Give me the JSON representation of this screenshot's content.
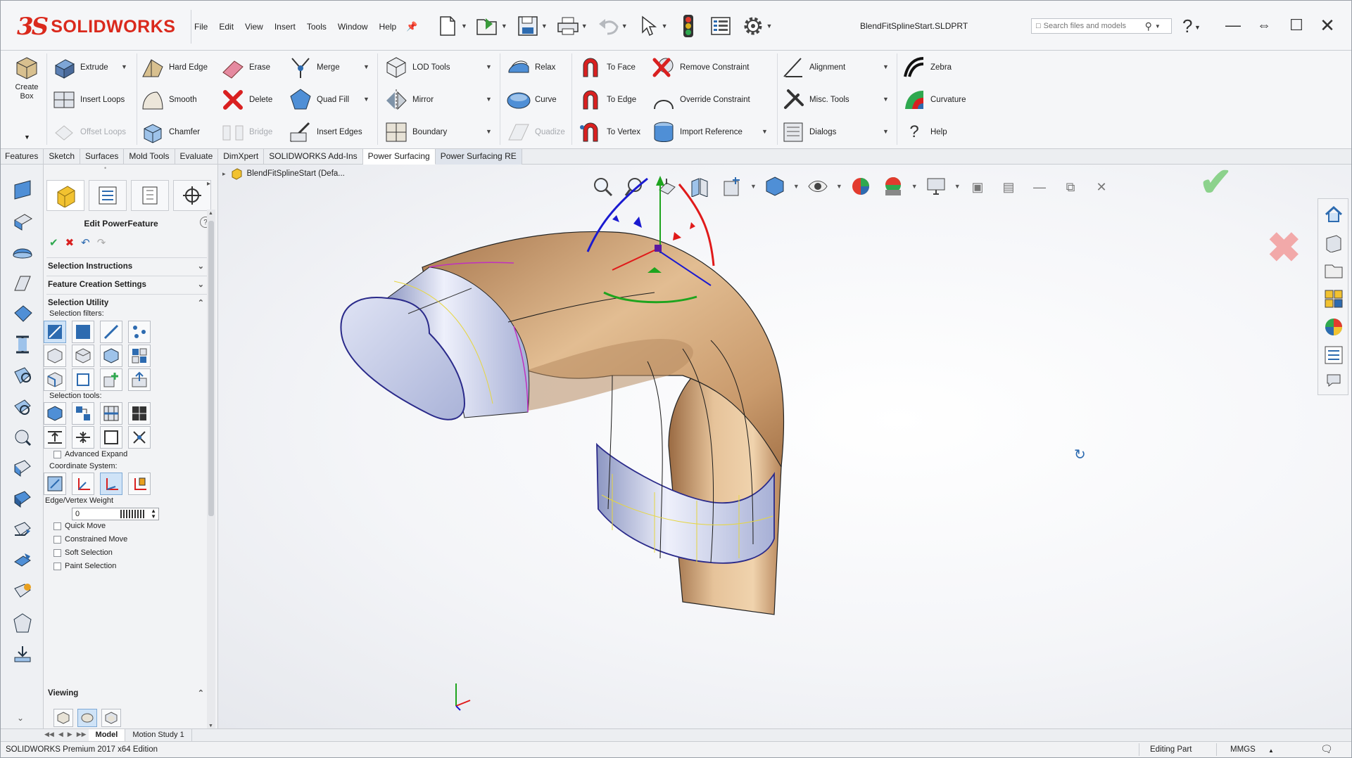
{
  "app": {
    "brand": "SOLIDWORKS",
    "document_title": "BlendFitSplineStart.SLDPRT"
  },
  "menus": [
    "File",
    "Edit",
    "View",
    "Insert",
    "Tools",
    "Window",
    "Help"
  ],
  "search": {
    "placeholder": "Search files and models"
  },
  "ribbon": {
    "create_box": "Create Box",
    "extrude": "Extrude",
    "insert_loops": "Insert Loops",
    "offset_loops": "Offset Loops",
    "hard_edge": "Hard Edge",
    "smooth": "Smooth",
    "chamfer": "Chamfer",
    "erase": "Erase",
    "delete": "Delete",
    "bridge": "Bridge",
    "merge": "Merge",
    "quad_fill": "Quad Fill",
    "insert_edges": "Insert Edges",
    "lod_tools": "LOD Tools",
    "mirror": "Mirror",
    "boundary": "Boundary",
    "relax": "Relax",
    "curve": "Curve",
    "quadize": "Quadize",
    "to_face": "To Face",
    "to_edge": "To Edge",
    "to_vertex": "To Vertex",
    "remove_constraint": "Remove Constraint",
    "override_constraint": "Override Constraint",
    "import_reference": "Import Reference",
    "alignment": "Alignment",
    "misc_tools": "Misc. Tools",
    "dialogs": "Dialogs",
    "zebra": "Zebra",
    "curvature": "Curvature",
    "help": "Help"
  },
  "tabs": [
    "Features",
    "Sketch",
    "Surfaces",
    "Mold Tools",
    "Evaluate",
    "DimXpert",
    "SOLIDWORKS Add-Ins",
    "Power Surfacing",
    "Power Surfacing RE"
  ],
  "active_tab": "Power Surfacing",
  "property_manager": {
    "title": "Edit PowerFeature",
    "help": "?",
    "groups": {
      "selection_instructions": "Selection Instructions",
      "feature_creation_settings": "Feature Creation Settings",
      "selection_utility": "Selection Utility",
      "viewing": "Viewing"
    },
    "selection_filters_label": "Selection filters:",
    "selection_tools_label": "Selection tools:",
    "advanced_expand": "Advanced Expand",
    "coordinate_system_label": "Coordinate System:",
    "edge_vertex_weight_label": "Edge/Vertex Weight",
    "edge_vertex_weight_value": "0",
    "checkboxes": [
      "Quick Move",
      "Constrained Move",
      "Soft Selection",
      "Paint Selection"
    ]
  },
  "tree_flyout": {
    "label": "BlendFitSplineStart  (Defa..."
  },
  "model_tabs": [
    "Model",
    "Motion Study 1"
  ],
  "status": {
    "product": "SOLIDWORKS Premium 2017 x64 Edition",
    "mode": "Editing Part",
    "units": "MMGS"
  },
  "colors": {
    "brand_red": "#da291c",
    "model_tan": "#d8b38a",
    "model_blue": "#c9d0ea",
    "active_tab_bg": "#ffffff"
  },
  "icons": {
    "search": "search-icon",
    "help": "help-icon",
    "ok": "check-icon",
    "cancel": "close-icon"
  }
}
